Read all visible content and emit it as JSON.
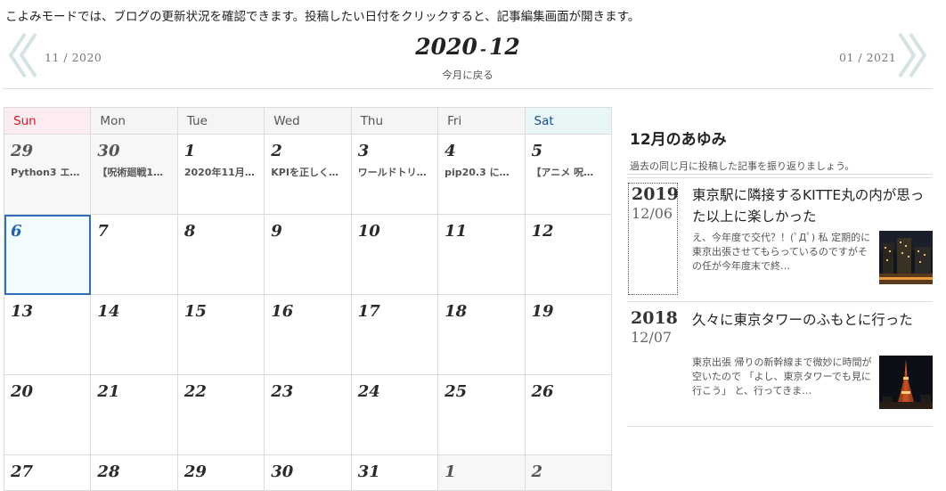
{
  "intro_text": "こよみモードでは、ブログの更新状況を確認できます。投稿したい日付をクリックすると、記事編集画面が開きます。",
  "nav": {
    "prev_label": "11 / 2020",
    "next_label": "01 / 2021",
    "year": "2020",
    "separator": "-",
    "month": "12",
    "back_label": "今月に戻る"
  },
  "weekdays": [
    "Sun",
    "Mon",
    "Tue",
    "Wed",
    "Thu",
    "Fri",
    "Sat"
  ],
  "weeks": [
    [
      {
        "day": "29",
        "post": "Python3 エ…",
        "other": true
      },
      {
        "day": "30",
        "post": "【呪術廻戦1…",
        "other": true
      },
      {
        "day": "1",
        "post": "2020年11月…"
      },
      {
        "day": "2",
        "post": "KPIを正しく…"
      },
      {
        "day": "3",
        "post": "ワールドトリ…"
      },
      {
        "day": "4",
        "post": "pip20.3 に…"
      },
      {
        "day": "5",
        "post": "【アニメ 呪…"
      }
    ],
    [
      {
        "day": "6",
        "today": true
      },
      {
        "day": "7"
      },
      {
        "day": "8"
      },
      {
        "day": "9"
      },
      {
        "day": "10"
      },
      {
        "day": "11"
      },
      {
        "day": "12"
      }
    ],
    [
      {
        "day": "13"
      },
      {
        "day": "14"
      },
      {
        "day": "15"
      },
      {
        "day": "16"
      },
      {
        "day": "17"
      },
      {
        "day": "18"
      },
      {
        "day": "19"
      }
    ],
    [
      {
        "day": "20"
      },
      {
        "day": "21"
      },
      {
        "day": "22"
      },
      {
        "day": "23"
      },
      {
        "day": "24"
      },
      {
        "day": "25"
      },
      {
        "day": "26"
      }
    ],
    [
      {
        "day": "27"
      },
      {
        "day": "28"
      },
      {
        "day": "29"
      },
      {
        "day": "30"
      },
      {
        "day": "31"
      },
      {
        "day": "1",
        "other": true
      },
      {
        "day": "2",
        "other": true
      }
    ]
  ],
  "sidebar": {
    "title": "12月のあゆみ",
    "description": "過去の同じ月に投稿した記事を振り返りましょう。",
    "items": [
      {
        "year": "2019",
        "month_day": "12/06",
        "title": "東京駅に隣接するKITTE丸の内が思った以上に楽しかった",
        "excerpt": "え、今年度で交代？！(ﾟДﾟ) 私 定期的に東京出張させてもらっているのですがその任が今年度末で終…",
        "thumbnail": "tokyo-night-photo"
      },
      {
        "year": "2018",
        "month_day": "12/07",
        "title": "久々に東京タワーのふもとに行った",
        "excerpt": "東京出張 帰りの新幹線まで微妙に時間が空いたので 「よし、東京タワーでも見に行こう」 と、行ってきま…",
        "thumbnail": "tokyo-tower-photo"
      }
    ]
  },
  "colors": {
    "sunday": "#e0182c",
    "saturday": "#1a4c8a",
    "today_border": "#2a6fb8"
  }
}
